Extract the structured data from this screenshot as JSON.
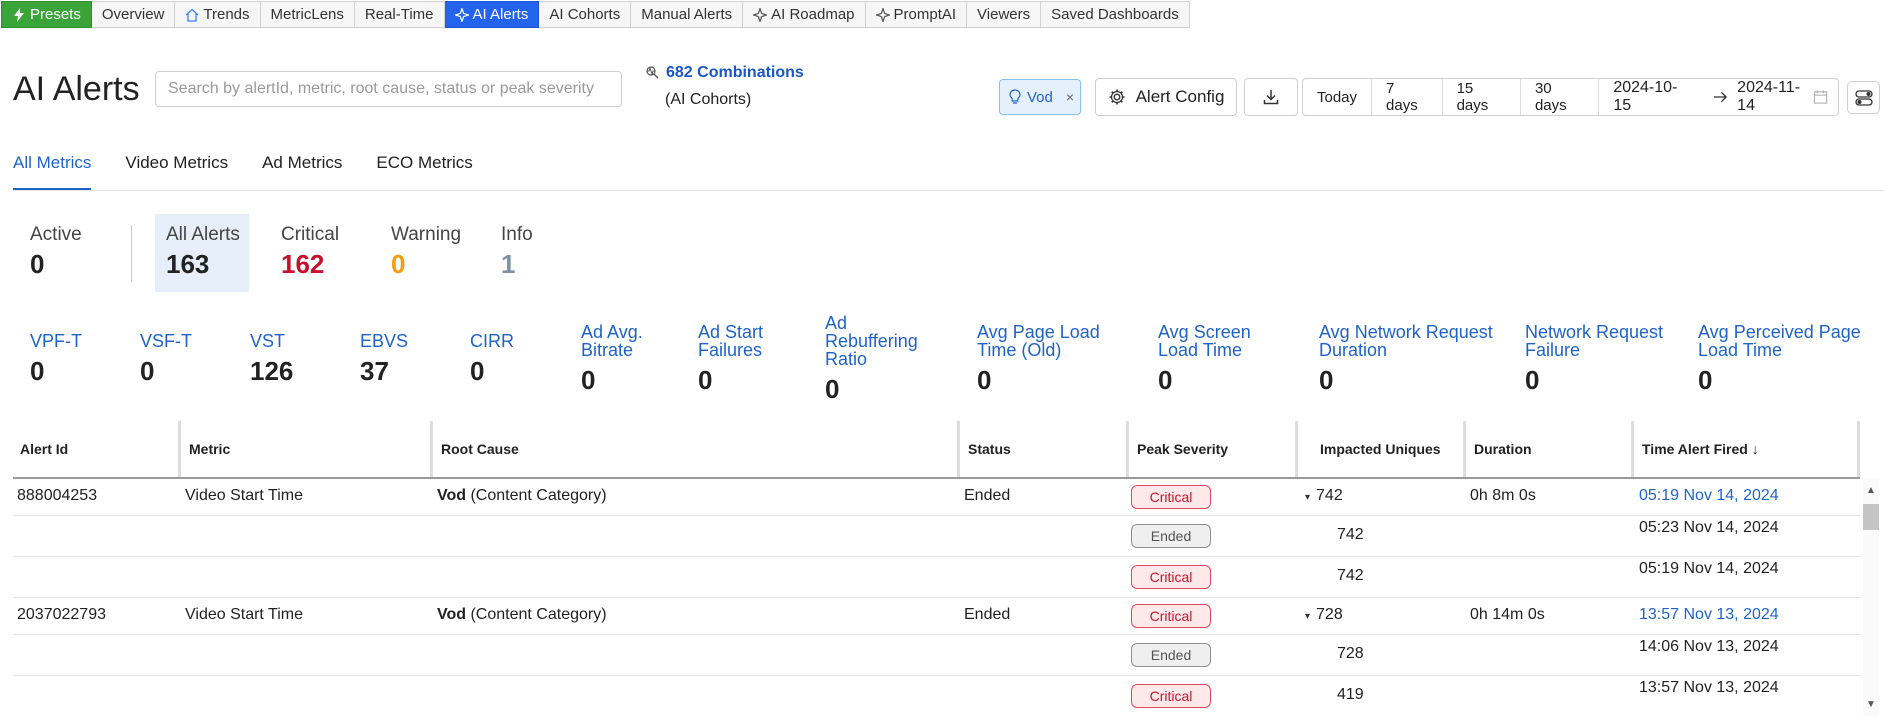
{
  "nav": {
    "tabs": [
      {
        "label": "Presets",
        "icon": "bolt-icon"
      },
      {
        "label": "Overview"
      },
      {
        "label": "Trends",
        "icon": "home-icon"
      },
      {
        "label": "MetricLens"
      },
      {
        "label": "Real-Time"
      },
      {
        "label": "AI Alerts",
        "icon": "sparkle-icon",
        "active": true
      },
      {
        "label": "AI Cohorts"
      },
      {
        "label": "Manual Alerts"
      },
      {
        "label": "AI Roadmap",
        "icon": "sparkle-icon"
      },
      {
        "label": "PromptAI",
        "icon": "sparkle-icon"
      },
      {
        "label": "Viewers"
      },
      {
        "label": "Saved Dashboards"
      }
    ]
  },
  "header": {
    "title": "AI Alerts",
    "search_placeholder": "Search by alertId, metric, root cause, status or peak severity",
    "combinations_label": "682 Combinations",
    "combinations_sub": "(AI Cohorts)",
    "filter_chip": "Vod",
    "filter_chip_close": "×",
    "alert_config_label": "Alert Config"
  },
  "daterange": {
    "presets": [
      "Today",
      "7 days",
      "15 days",
      "30 days"
    ],
    "start": "2024-10-15",
    "end": "2024-11-14"
  },
  "tabs": [
    {
      "label": "All Metrics",
      "active": true
    },
    {
      "label": "Video Metrics"
    },
    {
      "label": "Ad Metrics"
    },
    {
      "label": "ECO Metrics"
    }
  ],
  "summary": {
    "active": {
      "label": "Active",
      "value": "0"
    },
    "all_alerts": {
      "label": "All Alerts",
      "value": "163"
    },
    "critical": {
      "label": "Critical",
      "value": "162",
      "color": "#c8102e"
    },
    "warning": {
      "label": "Warning",
      "value": "0",
      "color": "#f39c12"
    },
    "info": {
      "label": "Info",
      "value": "1",
      "color": "#7f8fa6"
    }
  },
  "metrics": [
    {
      "label": "VPF-T",
      "value": "0"
    },
    {
      "label": "VSF-T",
      "value": "0"
    },
    {
      "label": "VST",
      "value": "126"
    },
    {
      "label": "EBVS",
      "value": "37"
    },
    {
      "label": "CIRR",
      "value": "0"
    },
    {
      "label": "Ad Avg. Bitrate",
      "value": "0"
    },
    {
      "label": "Ad Start Failures",
      "value": "0"
    },
    {
      "label": "Ad Rebuffering Ratio",
      "value": "0"
    },
    {
      "label": "Avg Page Load Time (Old)",
      "value": "0"
    },
    {
      "label": "Avg Screen Load Time",
      "value": "0"
    },
    {
      "label": "Avg Network Request Duration",
      "value": "0"
    },
    {
      "label": "Network Request Failure",
      "value": "0"
    },
    {
      "label": "Avg Perceived Page Load Time",
      "value": "0"
    }
  ],
  "table": {
    "columns": [
      "Alert Id",
      "Metric",
      "Root Cause",
      "Status",
      "Peak Severity",
      "Impacted Uniques",
      "Duration",
      "Time Alert Fired ↓"
    ],
    "rows": [
      {
        "alert_id": "888004253",
        "metric": "Video Start Time",
        "root_cause_bold": "Vod",
        "root_cause_rest": " (Content Category)",
        "status": "Ended",
        "severity": "Critical",
        "uniques": "742",
        "duration": "0h 8m 0s",
        "time": "05:19 Nov 14, 2024"
      },
      {
        "severity": "Ended",
        "uniques": "742",
        "time": "05:23 Nov 14, 2024"
      },
      {
        "severity": "Critical",
        "uniques": "742",
        "time": "05:19 Nov 14, 2024"
      },
      {
        "alert_id": "2037022793",
        "metric": "Video Start Time",
        "root_cause_bold": "Vod",
        "root_cause_rest": " (Content Category)",
        "status": "Ended",
        "severity": "Critical",
        "uniques": "728",
        "duration": "0h 14m 0s",
        "time": "13:57 Nov 13, 2024"
      },
      {
        "severity": "Ended",
        "uniques": "728",
        "time": "14:06 Nov 13, 2024"
      },
      {
        "severity": "Critical",
        "uniques": "419",
        "time": "13:57 Nov 13, 2024"
      }
    ],
    "caret": "▾"
  },
  "colors": {
    "accent": "#1f63c9",
    "presets": "#3aa33a",
    "active_tab": "#2463eb"
  }
}
